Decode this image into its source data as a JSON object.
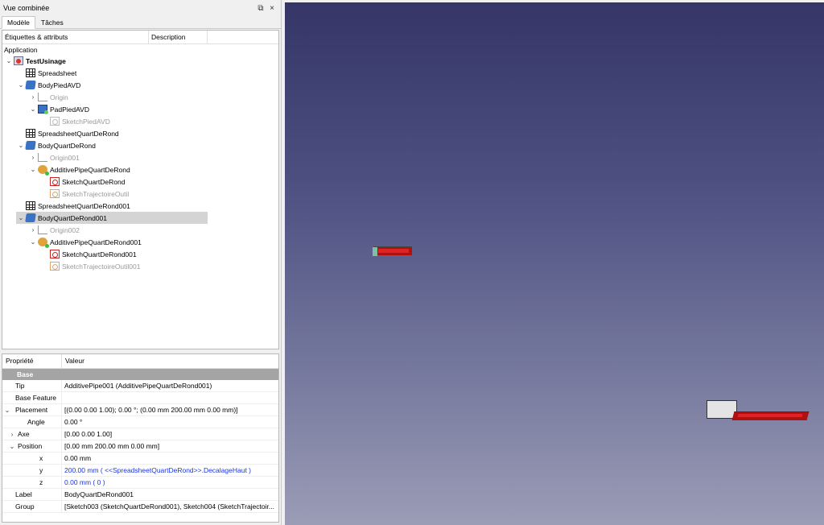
{
  "panel": {
    "title": "Vue combinée",
    "float_icon": "⧉",
    "close_icon": "×",
    "tabs": [
      {
        "label": "Modèle"
      },
      {
        "label": "Tâches"
      }
    ]
  },
  "tree": {
    "headers": {
      "col1": "Étiquettes & attributs",
      "col2": "Description"
    },
    "application_label": "Application",
    "items": [
      {
        "label": "TestUsinage",
        "icon": "document-icon",
        "expanded": true
      },
      {
        "label": "Spreadsheet",
        "icon": "spreadsheet-icon"
      },
      {
        "label": "BodyPiedAVD",
        "icon": "body-icon",
        "expanded": true
      },
      {
        "label": "Origin",
        "icon": "origin-icon",
        "collapsed": true
      },
      {
        "label": "PadPiedAVD",
        "icon": "pad-icon",
        "expanded": true
      },
      {
        "label": "SketchPiedAVD",
        "icon": "sketch-icon"
      },
      {
        "label": "SpreadsheetQuartDeRond",
        "icon": "spreadsheet-icon"
      },
      {
        "label": "BodyQuartDeRond",
        "icon": "body-icon",
        "expanded": true
      },
      {
        "label": "Origin001",
        "icon": "origin-icon",
        "collapsed": true
      },
      {
        "label": "AdditivePipeQuartDeRond",
        "icon": "additive-pipe-icon",
        "expanded": true
      },
      {
        "label": "SketchQuartDeRond",
        "icon": "sketch-icon"
      },
      {
        "label": "SketchTrajectoireOutil",
        "icon": "sketch-icon"
      },
      {
        "label": "SpreadsheetQuartDeRond001",
        "icon": "spreadsheet-icon"
      },
      {
        "label": "BodyQuartDeRond001",
        "icon": "body-icon",
        "expanded": true,
        "selected": true
      },
      {
        "label": "Origin002",
        "icon": "origin-icon",
        "collapsed": true
      },
      {
        "label": "AdditivePipeQuartDeRond001",
        "icon": "additive-pipe-icon",
        "expanded": true
      },
      {
        "label": "SketchQuartDeRond001",
        "icon": "sketch-icon"
      },
      {
        "label": "SketchTrajectoireOutil001",
        "icon": "sketch-icon"
      }
    ]
  },
  "properties": {
    "headers": {
      "property": "Propriété",
      "value": "Valeur"
    },
    "group": "Base",
    "rows": [
      {
        "key": "Tip",
        "value": "AdditivePipe001 (AdditivePipeQuartDeRond001)"
      },
      {
        "key": "Base Feature",
        "value": ""
      },
      {
        "key": "Placement",
        "value": "[(0.00 0.00 1.00); 0.00 °; (0.00 mm  200.00 mm  0.00 mm)]"
      },
      {
        "key": "Angle",
        "value": "0.00 °"
      },
      {
        "key": "Axe",
        "value": "[0.00 0.00 1.00]"
      },
      {
        "key": "Position",
        "value": "[0.00 mm  200.00 mm  0.00 mm]"
      },
      {
        "key": "x",
        "value": "0.00 mm"
      },
      {
        "key": "y",
        "value": "200.00 mm  ( <<SpreadsheetQuartDeRond>>.DecalageHaut )"
      },
      {
        "key": "z",
        "value": "0.00 mm  ( 0 )"
      },
      {
        "key": "Label",
        "value": "BodyQuartDeRond001"
      },
      {
        "key": "Group",
        "value": "[Sketch003 (SketchQuartDeRond001), Sketch004 (SketchTrajectoir..."
      }
    ]
  },
  "colors": {
    "viewport_top": "#353667",
    "viewport_bottom": "#9b9cb6",
    "selection": "#d4d4d4",
    "expression_text": "#1c35e0",
    "solid_red": "#e02222"
  }
}
